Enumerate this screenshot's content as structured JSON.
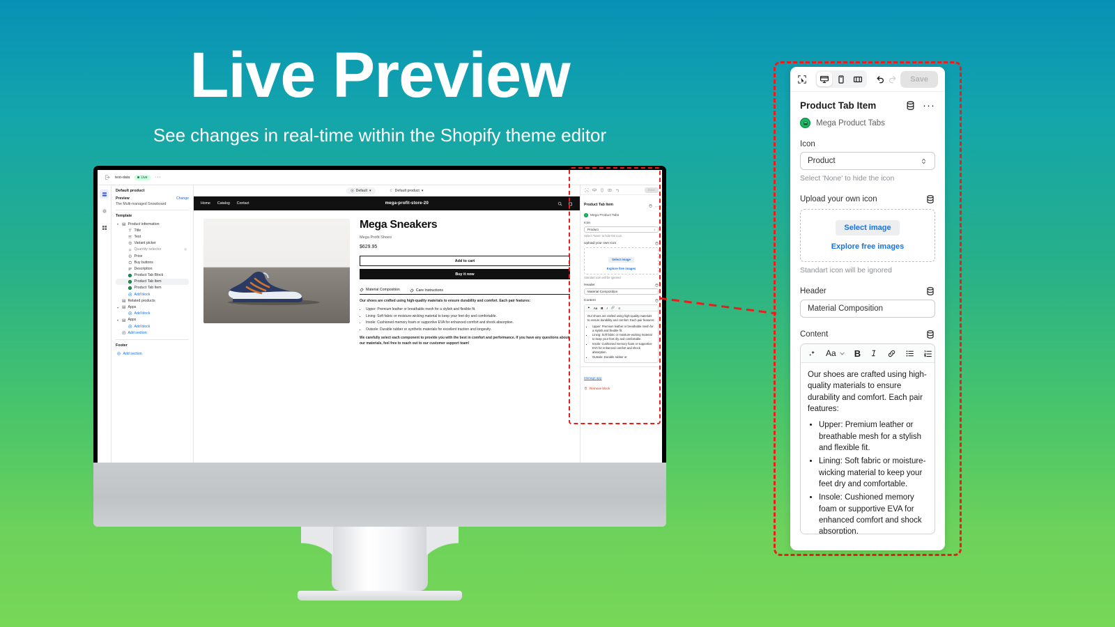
{
  "hero": {
    "title": "Live Preview",
    "subtitle": "See changes in real-time within the Shopify theme editor"
  },
  "colors": {
    "bg_top": "#0891b6",
    "bg_bottom": "#77d757",
    "highlight": "#ee1b1b",
    "link": "#1773e6",
    "app_green": "#1fb863",
    "danger": "#d72c0d"
  },
  "editor": {
    "topbar": {
      "store": "test-data",
      "status": "Live",
      "more": "···"
    },
    "rail": [
      {
        "name": "sections-icon",
        "active": true
      },
      {
        "name": "settings-icon",
        "active": false
      },
      {
        "name": "apps-icon",
        "active": false
      }
    ],
    "sidebar": {
      "heading": "Default product",
      "preview_label": "Preview",
      "change_link": "Change",
      "preview_value": "The Multi-managed Snowboard",
      "template_label": "Template",
      "tree": [
        {
          "label": "Product information",
          "level": 1,
          "icon": "section-icon",
          "caret": true
        },
        {
          "label": "Title",
          "level": 2,
          "icon": "text-title-icon"
        },
        {
          "label": "Text",
          "level": 2,
          "icon": "text-icon"
        },
        {
          "label": "Variant picker",
          "level": 2,
          "icon": "variant-icon"
        },
        {
          "label": "Quantity selector",
          "level": 2,
          "icon": "quantity-icon",
          "dim": true
        },
        {
          "label": "Price",
          "level": 2,
          "icon": "price-icon"
        },
        {
          "label": "Buy buttons",
          "level": 2,
          "icon": "cart-icon"
        },
        {
          "label": "Description",
          "level": 2,
          "icon": "description-icon"
        },
        {
          "label": "Product Tab Block",
          "level": 2,
          "icon": "app-dot-icon"
        },
        {
          "label": "Product Tab Item",
          "level": 2,
          "icon": "app-dot-icon",
          "selected": true
        },
        {
          "label": "Product Tab Item",
          "level": 2,
          "icon": "app-dot-icon"
        },
        {
          "label": "Add block",
          "level": 2,
          "icon": "plus-circle-icon",
          "blue": true
        },
        {
          "label": "Related products",
          "level": 1,
          "icon": "section-icon"
        },
        {
          "label": "Apps",
          "level": 1,
          "icon": "section-icon",
          "caret": true
        },
        {
          "label": "Add block",
          "level": 2,
          "icon": "plus-circle-icon",
          "blue": true
        },
        {
          "label": "Apps",
          "level": 1,
          "icon": "section-icon",
          "caret": true
        },
        {
          "label": "Add block",
          "level": 2,
          "icon": "plus-circle-icon",
          "blue": true
        },
        {
          "label": "Add section",
          "level": 1,
          "icon": "plus-circle-icon",
          "blue": true
        }
      ],
      "footer_label": "Footer",
      "footer_add": "Add section"
    },
    "preview_bar": {
      "theme_chip": "Default",
      "template_chip": "Default product"
    },
    "storefront": {
      "nav": [
        "Home",
        "Catalog",
        "Contact"
      ],
      "store_name": "mega-profit-store-20",
      "product": {
        "title": "Mega Sneakers",
        "vendor": "Mega Profit Shoes",
        "price": "$629.95",
        "add_to_cart": "Add to cart",
        "buy_now": "Buy it now"
      },
      "tabs": [
        {
          "label": "Material Composition",
          "active": true
        },
        {
          "label": "Care Instructions",
          "active": false
        }
      ],
      "tab_intro": "Our shoes are crafted using high-quality materials to ensure durability and comfort. Each pair features:",
      "tab_bullets": [
        "Upper: Premium leather or breathable mesh for a stylish and flexible fit.",
        "Lining: Soft fabric or moisture-wicking material to keep your feet dry and comfortable.",
        "Insole: Cushioned memory foam or supportive EVA for enhanced comfort and shock absorption.",
        "Outsole: Durable rubber or synthetic materials for excellent traction and longevity."
      ],
      "tab_outro": "We carefully select each component to provide you with the best in comfort and performance. If you have any questions about our materials, feel free to reach out to our customer support team!"
    }
  },
  "panel": {
    "toolbar": {
      "select_tool": "select-tool",
      "desktop": "desktop-view",
      "mobile": "mobile-view",
      "fullscreen": "fullscreen-view",
      "undo": "undo",
      "redo": "redo",
      "save_label": "Save"
    },
    "title": "Product Tab Item",
    "app_name": "Mega Product Tabs",
    "fields": {
      "icon_label": "Icon",
      "icon_value": "Product",
      "icon_help": "Select 'None' to hide the icon",
      "upload_label": "Upload your own icon",
      "select_image": "Select image",
      "explore_free": "Explore free images",
      "upload_help": "Standart icon will be ignored",
      "header_label": "Header",
      "header_value": "Material Composition",
      "content_label": "Content"
    },
    "content": {
      "intro": "Our shoes are crafted using high-quality materials to ensure durability and comfort. Each pair features:",
      "bullets": [
        "Upper: Premium leather or breathable mesh for a stylish and flexible fit.",
        "Lining: Soft fabric or moisture-wicking material to keep your feet dry and comfortable.",
        "Insole: Cushioned memory foam or supportive EVA for enhanced comfort and shock absorption.",
        "Outsole: Durable rubber or"
      ]
    },
    "footer": {
      "manage_app": "Manage app",
      "remove_block": "Remove block"
    }
  }
}
